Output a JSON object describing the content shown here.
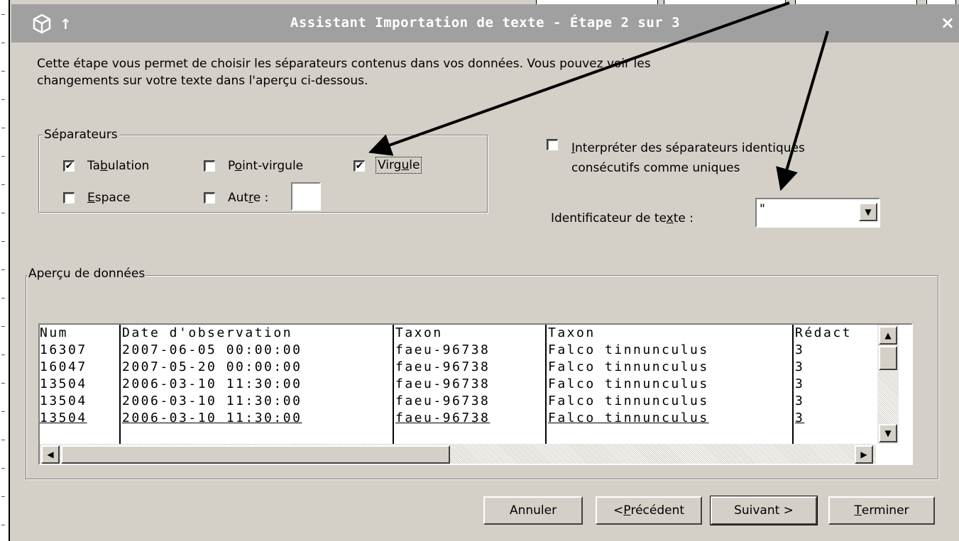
{
  "window": {
    "title": "Assistant Importation de texte - Étape 2 sur 3",
    "close_glyph": "×",
    "pin_glyph": "↑",
    "app_icon": "cube-icon"
  },
  "description": {
    "line1": "Cette étape vous permet de choisir les séparateurs contenus dans vos données. Vous pouvez voir les",
    "line2": "changements sur votre texte dans l'aperçu ci-dessous."
  },
  "separators": {
    "legend": "Séparateurs",
    "tab": {
      "pre": "Ta",
      "key": "b",
      "post": "ulation",
      "checked": true
    },
    "semicolon": {
      "pre": "P",
      "key": "o",
      "post": "int-virgule",
      "checked": false
    },
    "comma": {
      "pre": "Virg",
      "key": "u",
      "post": "le",
      "checked": true
    },
    "space": {
      "pre": "",
      "key": "E",
      "post": "space",
      "checked": false
    },
    "other": {
      "pre": "Aut",
      "key": "r",
      "post": "e :",
      "checked": false,
      "value": ""
    }
  },
  "consecutive": {
    "key": "I",
    "line1": "nterpréter des séparateurs identiques",
    "line2": "consécutifs comme uniques",
    "checked": false
  },
  "text_qualifier": {
    "pre": "Identificateur de te",
    "key": "x",
    "post": "te :",
    "value": "\""
  },
  "preview": {
    "legend": "Aperçu de données",
    "columns": [
      "Num",
      "Date d'observation",
      "Taxon",
      "Taxon",
      "Rédact"
    ],
    "rows": [
      [
        "16307",
        "2007-06-05 00:00:00",
        "faeu-96738",
        "Falco tinnunculus",
        "3"
      ],
      [
        "16047",
        "2007-05-20 00:00:00",
        "faeu-96738",
        "Falco tinnunculus",
        "3"
      ],
      [
        "13504",
        "2006-03-10 11:30:00",
        "faeu-96738",
        "Falco tinnunculus",
        "3"
      ],
      [
        "13504",
        "2006-03-10 11:30:00",
        "faeu-96738",
        "Falco tinnunculus",
        "3"
      ],
      [
        "13504",
        "2006-03-10 11:30:00",
        "faeu-96738",
        "Falco tinnunculus",
        "3"
      ]
    ]
  },
  "buttons": {
    "cancel": {
      "label": "Annuler"
    },
    "previous": {
      "pre": "< ",
      "key": "P",
      "post": "récédent"
    },
    "next": {
      "label": "Suivant >"
    },
    "finish": {
      "pre": "",
      "key": "T",
      "post": "erminer"
    }
  }
}
